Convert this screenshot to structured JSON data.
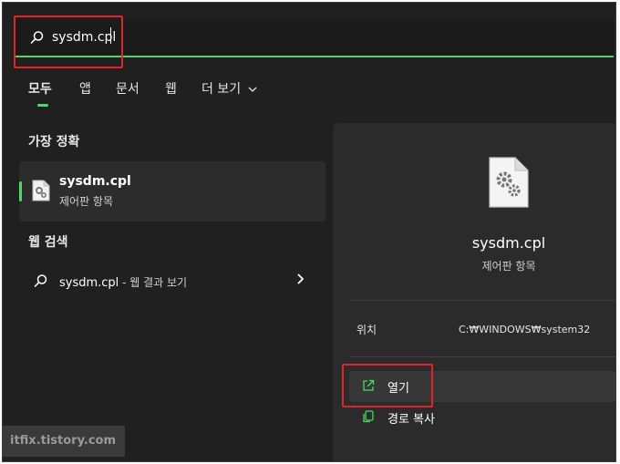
{
  "search": {
    "query": "sysdm.cpl"
  },
  "tabs": [
    {
      "label": "모두"
    },
    {
      "label": "앱"
    },
    {
      "label": "문서"
    },
    {
      "label": "웹"
    },
    {
      "label": "더 보기"
    }
  ],
  "best_match": {
    "section_title": "가장 정확",
    "title": "sysdm.cpl",
    "subtitle": "제어판 항목"
  },
  "web_search": {
    "section_title": "웹 검색",
    "query": "sysdm.cpl",
    "suffix": " - 웹 결과 보기"
  },
  "details": {
    "title": "sysdm.cpl",
    "subtitle": "제어판 항목",
    "location_label": "위치",
    "location_value": "C:₩WINDOWS₩system32",
    "actions": [
      {
        "label": "열기",
        "icon": "open-external-icon"
      },
      {
        "label": "경로 복사",
        "icon": "copy-icon"
      }
    ]
  },
  "watermark": "itfix.tistory.com",
  "colors": {
    "accent": "#4cd964",
    "highlight_box": "#e0242b",
    "background": "#202020",
    "panel": "#2b2b2b"
  }
}
